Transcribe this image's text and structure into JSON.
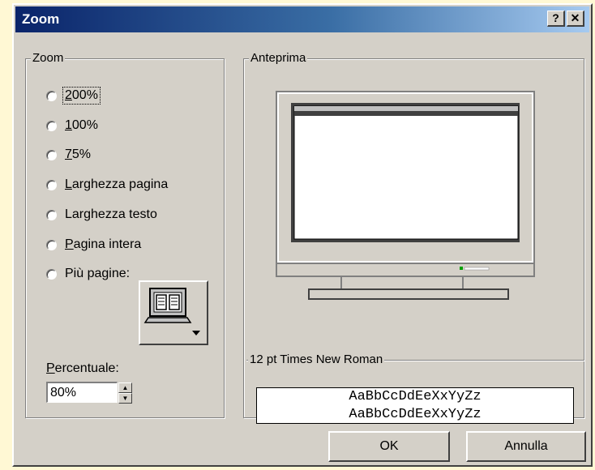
{
  "window": {
    "title": "Zoom",
    "help_glyph": "?",
    "close_glyph": "✕"
  },
  "zoom_group": {
    "label": "Zoom",
    "options": [
      {
        "label": "200%",
        "mnemonic": "2",
        "rest": "00%",
        "selected": false,
        "focused": true
      },
      {
        "label": "100%",
        "mnemonic": "1",
        "rest": "00%",
        "selected": false
      },
      {
        "label": "75%",
        "mnemonic": "7",
        "rest": "5%",
        "selected": false
      },
      {
        "label": "Larghezza pagina",
        "mnemonic": "L",
        "rest": "arghezza pagina",
        "selected": false
      },
      {
        "label": "Larghezza testo",
        "pre": "Lar",
        "mnemonic": "g",
        "rest": "hezza testo",
        "selected": false
      },
      {
        "label": "Pagina intera",
        "mnemonic": "P",
        "rest": "agina intera",
        "selected": false
      },
      {
        "label": "Più pagine:",
        "pre": "Più pa",
        "mnemonic": "g",
        "rest": "ine:",
        "selected": false
      }
    ],
    "pages_button_icon": "multiple-pages-monitor-icon"
  },
  "percentage": {
    "label_first": "P",
    "label_rest": "ercentuale:",
    "value": "80%"
  },
  "preview_group": {
    "label": "Anteprima",
    "monitor_icon": "monitor-preview-icon"
  },
  "font_group": {
    "label": "12 pt Times New Roman",
    "sample_line1": "AaBbCcDdEeXxYyZz",
    "sample_line2": "AaBbCcDdEeXxYyZz"
  },
  "buttons": {
    "ok": "OK",
    "cancel": "Annulla"
  },
  "colors": {
    "dialog_face": "#d4d0c8",
    "title_start": "#0a246a",
    "title_end": "#a6caf0",
    "background": "#fff8d4"
  }
}
